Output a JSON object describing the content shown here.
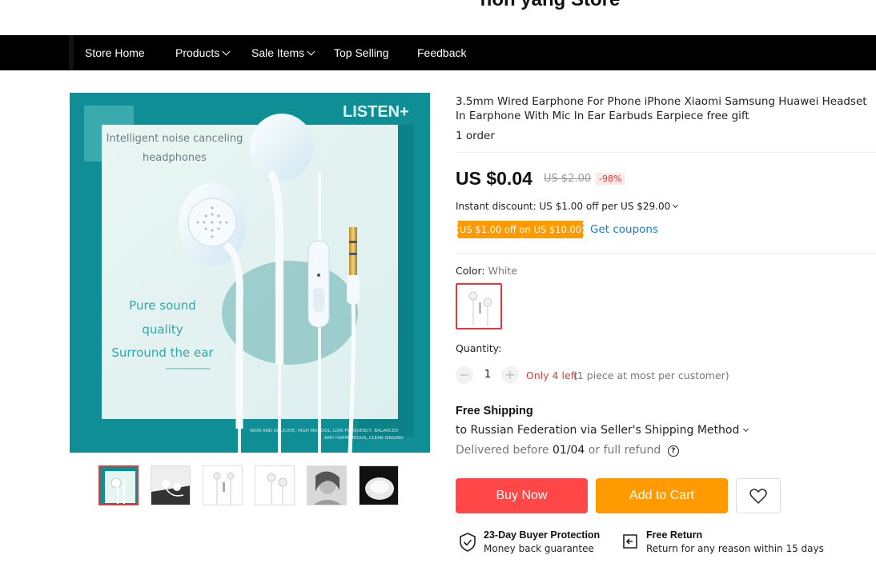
{
  "store": {
    "name": "hon yang Store"
  },
  "nav": {
    "items": [
      {
        "label": "Store Home"
      },
      {
        "label": "Products"
      },
      {
        "label": "Sale Items"
      },
      {
        "label": "Top Selling"
      },
      {
        "label": "Feedback"
      }
    ]
  },
  "gallery": {
    "main_image": {
      "brand_text": "LISTEN+",
      "headline_1": "Intelligent noise canceling",
      "headline_2": "headphones",
      "feature_1": "Pure sound",
      "feature_2": "quality",
      "feature_3": "Surround the ear",
      "footer_text_1": "NION AND DELICATE, HIGH MODDOL, LOW FREQUENCY, BALANCED",
      "footer_text_2": "AND HARMONIOUS, CLEAR SINGING"
    },
    "thumbnail_count": 6,
    "active_thumbnail": 1
  },
  "product": {
    "title": "3.5mm Wired Earphone For Phone iPhone Xiaomi Samsung Huawei Headset In Earphone With Mic In Ear Earbuds Earpiece free gift",
    "orders": "1 order",
    "price": "US $0.04",
    "old_price": "US $2.00",
    "discount": "-98%",
    "instant_discount": "Instant discount: US $1.00 off per US $29.00",
    "coupon_tag": "US $1.00 off on US $10.00",
    "coupon_link": "Get coupons",
    "color_label": "Color:",
    "color_value": "White",
    "quantity_label": "Quantity:",
    "quantity_minus": "−",
    "quantity_value": "1",
    "quantity_plus": "+",
    "stock": "Only 4 left",
    "stock_note": "(1 piece at most per customer)"
  },
  "shipping": {
    "title": "Free Shipping",
    "route": "to Russian Federation via Seller's Shipping Method",
    "delivery_prefix": "Delivered before",
    "delivery_date": "01/04",
    "delivery_suffix": "or full refund",
    "help_glyph": "?"
  },
  "actions": {
    "buy_now": "Buy Now",
    "add_to_cart": "Add to Cart"
  },
  "features": {
    "protection_title": "23-Day Buyer Protection",
    "protection_sub": "Money back guarantee",
    "return_title": "Free Return",
    "return_sub": "Return for any reason within 15 days"
  },
  "colors": {
    "accent_red": "#ff4747",
    "accent_orange": "#ff9a00",
    "link_blue": "#1b7cc4",
    "nav_bg": "#000000",
    "image_teal": "#0f8f95"
  },
  "icons": [
    "chevron-down-icon",
    "heart-icon",
    "shield-check-icon",
    "return-box-icon",
    "question-circle-icon"
  ]
}
